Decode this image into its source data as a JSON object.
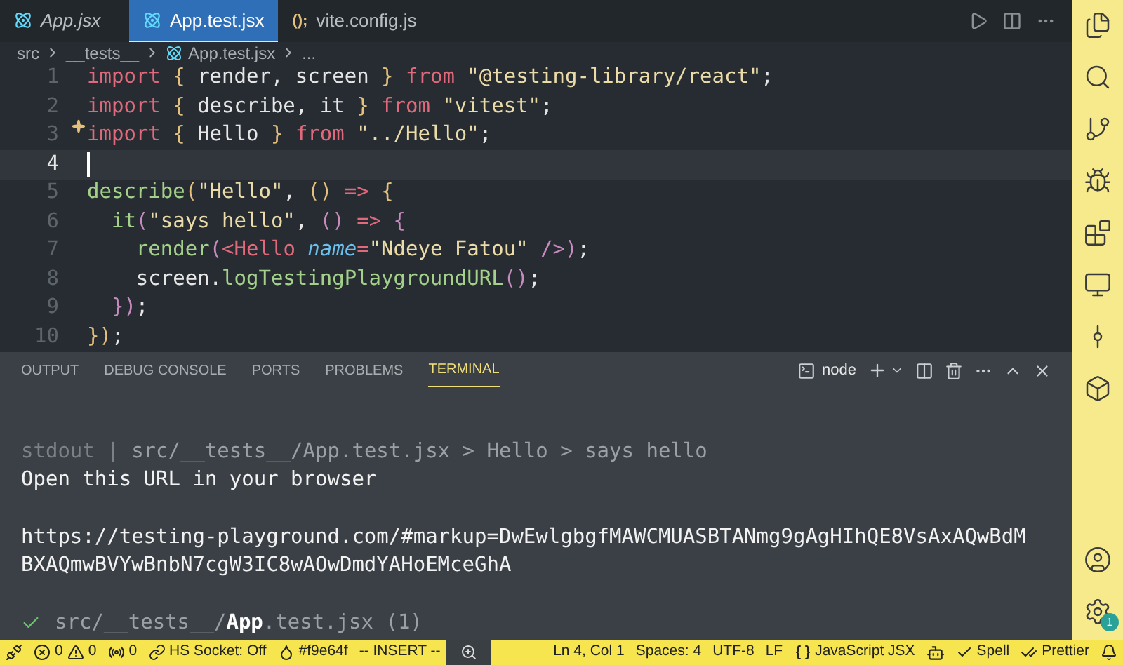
{
  "tabs": [
    {
      "label": "App.jsx",
      "selected": false,
      "italic": true
    },
    {
      "label": "App.test.jsx",
      "selected": true,
      "italic": false
    },
    {
      "label": "vite.config.js",
      "glyph": "();",
      "selected": false,
      "italic": false
    }
  ],
  "breadcrumb": [
    "src",
    "__tests__",
    "App.test.jsx",
    "..."
  ],
  "code": [
    {
      "number": "1",
      "current": false,
      "tokens": [
        {
          "kind": "kw",
          "text": "import "
        },
        {
          "kind": "brace",
          "text": "{ "
        },
        {
          "kind": "plain",
          "text": "render, screen "
        },
        {
          "kind": "brace",
          "text": "} "
        },
        {
          "kind": "kw",
          "text": "from "
        },
        {
          "kind": "str",
          "text": "\"@testing-library/react\""
        },
        {
          "kind": "plain",
          "text": ";"
        }
      ]
    },
    {
      "number": "2",
      "current": false,
      "tokens": [
        {
          "kind": "kw",
          "text": "import "
        },
        {
          "kind": "brace",
          "text": "{ "
        },
        {
          "kind": "plain",
          "text": "describe, it "
        },
        {
          "kind": "brace",
          "text": "} "
        },
        {
          "kind": "kw",
          "text": "from "
        },
        {
          "kind": "str",
          "text": "\"vitest\""
        },
        {
          "kind": "plain",
          "text": ";"
        }
      ]
    },
    {
      "number": "3",
      "current": false,
      "tokens": [
        {
          "kind": "kw",
          "text": "import "
        },
        {
          "kind": "brace",
          "text": "{ "
        },
        {
          "kind": "plain",
          "text": "Hello "
        },
        {
          "kind": "brace",
          "text": "} "
        },
        {
          "kind": "kw",
          "text": "from "
        },
        {
          "kind": "str",
          "text": "\"../Hello\""
        },
        {
          "kind": "plain",
          "text": ";"
        }
      ],
      "sparkle": true
    },
    {
      "number": "4",
      "current": true
    },
    {
      "number": "5",
      "current": false,
      "tokens": [
        {
          "kind": "fn",
          "text": "describe"
        },
        {
          "kind": "brace",
          "text": "("
        },
        {
          "kind": "str",
          "text": "\"Hello\""
        },
        {
          "kind": "plain",
          "text": ", "
        },
        {
          "kind": "brace",
          "text": "() "
        },
        {
          "kind": "kw",
          "text": "=> "
        },
        {
          "kind": "brace",
          "text": "{"
        }
      ]
    },
    {
      "number": "6",
      "current": false,
      "tokens": [
        {
          "kind": "fn",
          "text": "  it"
        },
        {
          "kind": "paren",
          "text": "("
        },
        {
          "kind": "str",
          "text": "\"says hello\""
        },
        {
          "kind": "plain",
          "text": ", "
        },
        {
          "kind": "paren",
          "text": "() "
        },
        {
          "kind": "kw",
          "text": "=> "
        },
        {
          "kind": "paren",
          "text": "{"
        }
      ]
    },
    {
      "number": "7",
      "current": false,
      "tokens": [
        {
          "kind": "fn",
          "text": "    render"
        },
        {
          "kind": "paren",
          "text": "("
        },
        {
          "kind": "kw",
          "text": "<Hello "
        },
        {
          "kind": "attr",
          "text": "name"
        },
        {
          "kind": "kw",
          "text": "="
        },
        {
          "kind": "str",
          "text": "\"Ndeye Fatou\" "
        },
        {
          "kind": "paren",
          "text": "/>)"
        },
        {
          "kind": "plain",
          "text": ";"
        }
      ]
    },
    {
      "number": "8",
      "current": false,
      "tokens": [
        {
          "kind": "plain",
          "text": "    screen."
        },
        {
          "kind": "fn",
          "text": "logTestingPlaygroundURL"
        },
        {
          "kind": "paren",
          "text": "()"
        },
        {
          "kind": "plain",
          "text": ";"
        }
      ]
    },
    {
      "number": "9",
      "current": false,
      "tokens": [
        {
          "kind": "paren",
          "text": "  })"
        },
        {
          "kind": "plain",
          "text": ";"
        }
      ]
    },
    {
      "number": "10",
      "current": false,
      "tokens": [
        {
          "kind": "brace",
          "text": "})"
        },
        {
          "kind": "plain",
          "text": ";"
        }
      ]
    }
  ],
  "panel_tabs": [
    {
      "label": "OUTPUT",
      "selected": false
    },
    {
      "label": "DEBUG CONSOLE",
      "selected": false
    },
    {
      "label": "PORTS",
      "selected": false
    },
    {
      "label": "PROBLEMS",
      "selected": false
    },
    {
      "label": "TERMINAL",
      "selected": true
    }
  ],
  "terminal_name": "node",
  "terminal": [
    {
      "kind": "stdout",
      "prefix": "stdout |",
      "text": "src/__tests__/App.test.jsx > Hello > says hello"
    },
    {
      "kind": "text",
      "text": "Open this URL in your browser"
    },
    {
      "kind": "blank"
    },
    {
      "kind": "text",
      "text": "https://testing-playground.com/#markup=DwEwlgbgfMAWCMUASBTANmg9gAgHIhQE8VsAxAQwBdM"
    },
    {
      "kind": "text",
      "text": "BXAQmwBVYwBnbN7cgW3IC8wAOwDmdYAHoEMceGhA"
    },
    {
      "kind": "pass",
      "dir": "src/__tests__/",
      "file": "App",
      "rest": ".test.jsx (1)"
    }
  ],
  "settings_badge": "1",
  "status_left": [
    {
      "kind": "remote"
    },
    {
      "kind": "problems",
      "errors": "0",
      "warnings": "0"
    },
    {
      "kind": "ports",
      "text": "0"
    },
    {
      "kind": "socket",
      "text": "HS Socket: Off"
    },
    {
      "kind": "color",
      "text": "#f9e64f"
    },
    {
      "kind": "text",
      "text": "-- INSERT --"
    },
    {
      "kind": "zoom"
    }
  ],
  "status_right": [
    {
      "kind": "text",
      "text": "Ln 4, Col 1"
    },
    {
      "kind": "text",
      "text": "Spaces: 4"
    },
    {
      "kind": "text",
      "text": "UTF-8"
    },
    {
      "kind": "text",
      "text": "LF"
    },
    {
      "kind": "lang",
      "text": "JavaScript JSX"
    },
    {
      "kind": "copilot"
    },
    {
      "kind": "check",
      "text": "Spell"
    },
    {
      "kind": "prettier",
      "text": "Prettier"
    },
    {
      "kind": "bell"
    }
  ]
}
